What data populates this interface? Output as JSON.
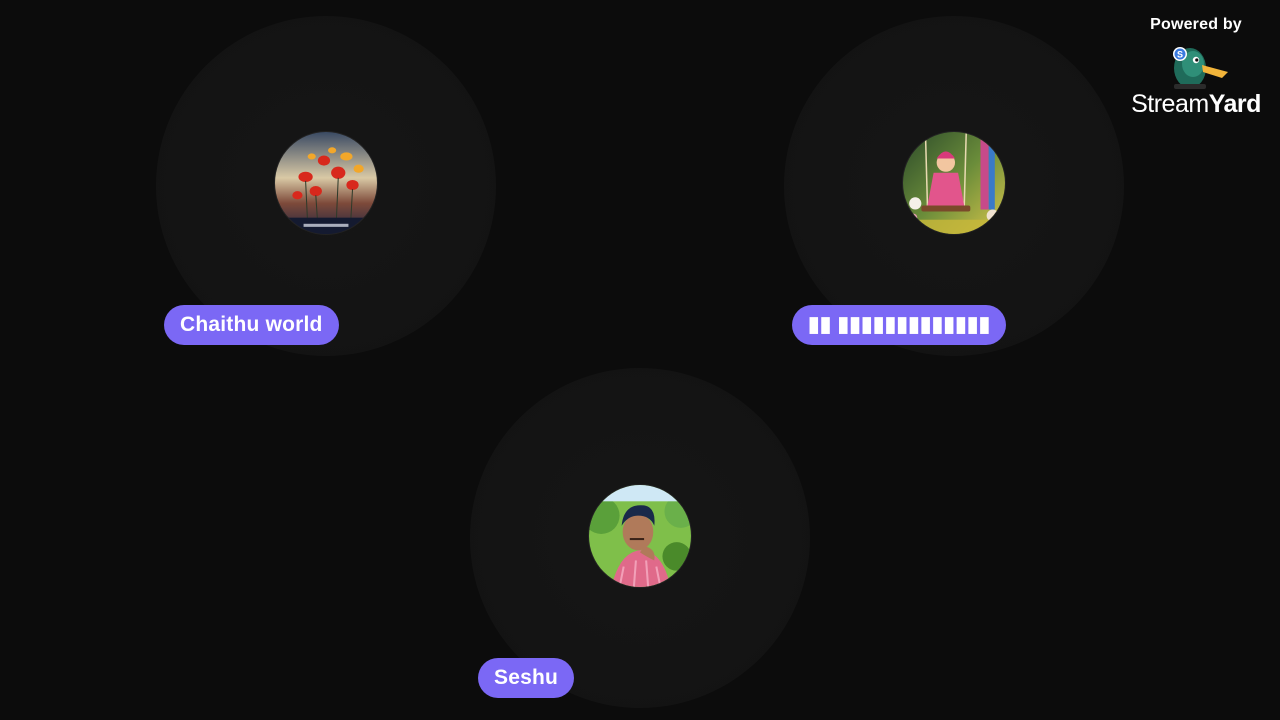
{
  "branding": {
    "powered_by": "Powered by",
    "brand_part1": "Stream",
    "brand_part2": "Yard",
    "logo_icon": "duck-icon"
  },
  "participants": [
    {
      "name": "Chaithu world",
      "avatar": "flowers-avatar"
    },
    {
      "name": "▮▮ ▮▮▮▮▮▮▮▮▮▮▮▮▮",
      "avatar": "child-on-swing-avatar"
    },
    {
      "name": "Seshu",
      "avatar": "man-photo-avatar"
    }
  ],
  "colors": {
    "background": "#0c0c0c",
    "tile": "#151515",
    "name_tag": "#7b68f5",
    "text": "#ffffff"
  }
}
